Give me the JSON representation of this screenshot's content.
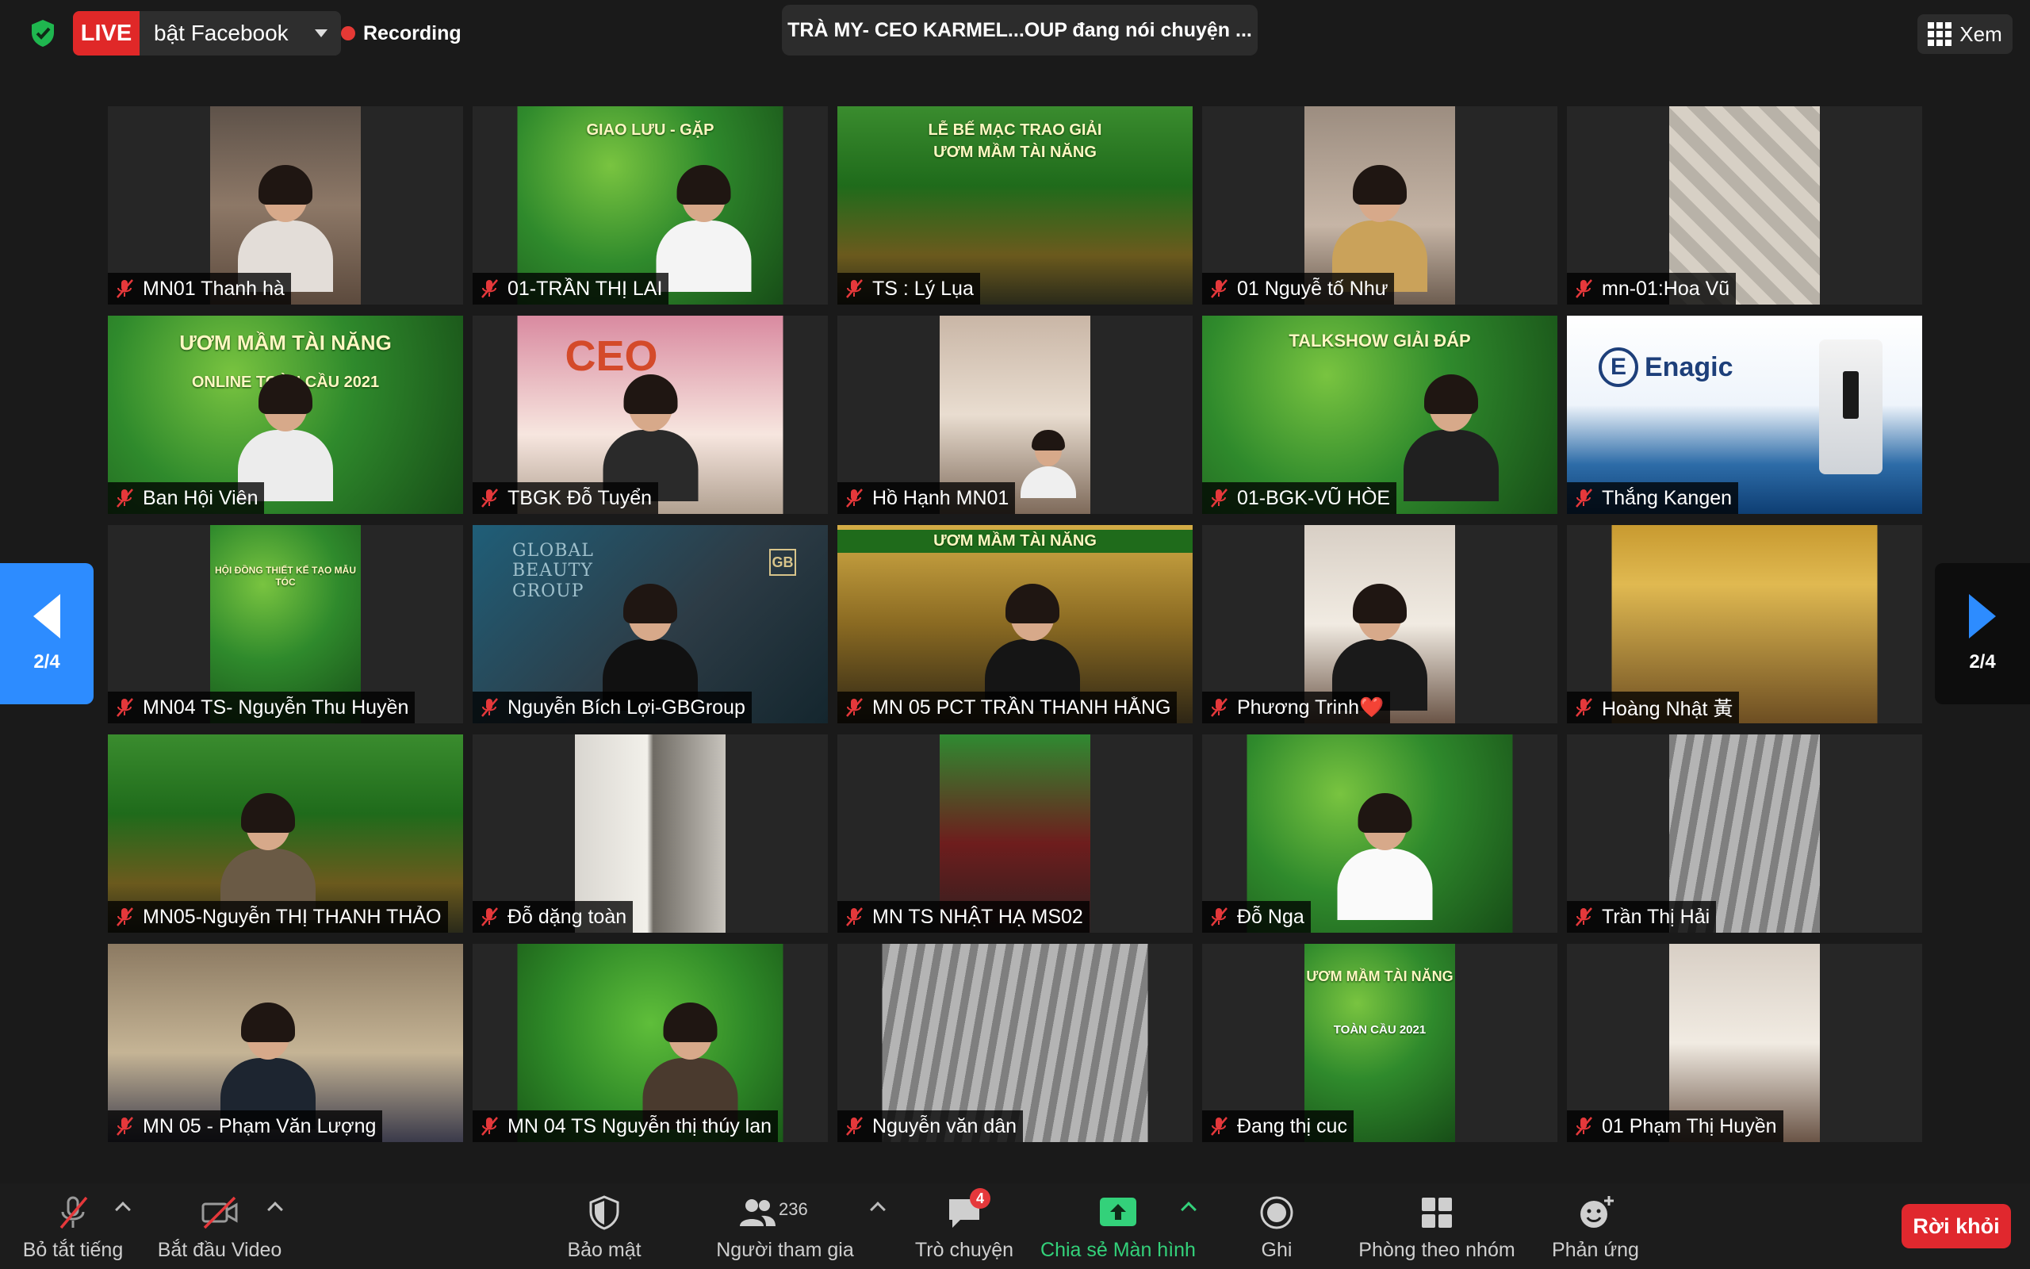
{
  "top": {
    "live_badge": "LIVE",
    "live_label": "bật Facebook",
    "recording": "Recording",
    "speaker": "TRÀ MY- CEO KARMEL...OUP đang nói chuyện ...",
    "view_label": "Xem"
  },
  "pager": {
    "prev": "2/4",
    "next": "2/4"
  },
  "tiles": [
    {
      "name": "MN01 Thanh hà"
    },
    {
      "name": "01-TRẦN THỊ LAI"
    },
    {
      "name": "TS : Lý Lụa"
    },
    {
      "name": "01 Nguyễ tố Như"
    },
    {
      "name": "mn-01:Hoa Vũ"
    },
    {
      "name": "Ban Hội Viên"
    },
    {
      "name": "TBGK Đỗ Tuyển"
    },
    {
      "name": "Hồ Hạnh MN01"
    },
    {
      "name": "01-BGK-VŨ HÒE"
    },
    {
      "name": "Thắng Kangen"
    },
    {
      "name": "MN04 TS- Nguyễn Thu Huyền"
    },
    {
      "name": "Nguyễn Bích Lợi-GBGroup"
    },
    {
      "name": "MN 05 PCT TRẦN THANH HẰNG"
    },
    {
      "name": "Phương Trinh❤️"
    },
    {
      "name": "Hoàng Nhật 黃"
    },
    {
      "name": "MN05-Nguyễn THỊ THANH THẢO"
    },
    {
      "name": "Đỗ dặng toàn"
    },
    {
      "name": "MN TS NHẬT HẠ MS02"
    },
    {
      "name": "Đỗ Nga"
    },
    {
      "name": "Trần Thị Hải"
    },
    {
      "name": "MN 05 - Phạm Văn Lượng"
    },
    {
      "name": "MN 04 TS Nguyễn thị thúy lan"
    },
    {
      "name": "Nguyễn văn dân"
    },
    {
      "name": "Đang thị cuc"
    },
    {
      "name": "01 Phạm Thị Huyền"
    }
  ],
  "tile_text": {
    "banner_1": "GIAO LƯU - GẶP",
    "banner_2": "LỄ BẾ MẠC TRAO GIẢI",
    "banner_2b": "ƯƠM MẦM TÀI NĂNG",
    "banner_3": "ƯƠM MẦM TÀI NĂNG",
    "banner_3b": "ONLINE TOÀN CẦU 2021",
    "banner_4": "TALKSHOW GIẢI ĐÁP",
    "banner_5": "HỘI ĐỒNG THIẾT KẾ TẠO MẪU TÓC",
    "banner_6": "ƯƠM MẦM TÀI NĂNG",
    "banner_7": "ONLINE TOÀN CẦU 2021",
    "banner_8": "ƯƠM MẦM TÀI NĂNG",
    "banner_9": "TOÀN CẦU 2021",
    "enagic": "Enagic",
    "enagic_mark": "E",
    "global": "GLOBAL\nBEAUTY\nGROUP",
    "cb": "GB",
    "ceo": "CEO"
  },
  "toolbar": {
    "mute": "Bỏ tắt tiếng",
    "video": "Bắt đầu Video",
    "security": "Bảo mật",
    "participants": "Người tham gia",
    "participants_count": "236",
    "chat": "Trò chuyện",
    "chat_badge": "4",
    "share": "Chia sẻ Màn hình",
    "record": "Ghi",
    "breakout": "Phòng theo nhóm",
    "reactions": "Phản ứng",
    "leave": "Rời khỏi"
  },
  "colors": {
    "accent": "#2d8cff",
    "live": "#e02828",
    "share_green": "#33d17a",
    "leave_red": "#e0282e",
    "muted_red": "#e5383b"
  }
}
